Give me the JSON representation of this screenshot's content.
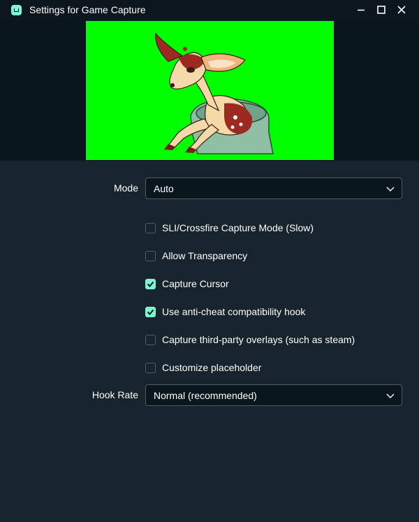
{
  "window": {
    "title": "Settings for Game Capture",
    "icon": "streamlabs-app-icon",
    "controls": [
      "minimize-icon",
      "maximize-icon",
      "close-icon"
    ]
  },
  "preview": {
    "background_color": "#00ff00",
    "subject": "deer-in-teacup-illustration"
  },
  "form": {
    "mode": {
      "label": "Mode",
      "value": "Auto"
    },
    "checkboxes": [
      {
        "label": "SLI/Crossfire Capture Mode (Slow)",
        "checked": false
      },
      {
        "label": "Allow Transparency",
        "checked": false
      },
      {
        "label": "Capture Cursor",
        "checked": true
      },
      {
        "label": "Use anti-cheat compatibility hook",
        "checked": true
      },
      {
        "label": "Capture third-party overlays (such as steam)",
        "checked": false
      },
      {
        "label": "Customize placeholder",
        "checked": false
      }
    ],
    "hook_rate": {
      "label": "Hook Rate",
      "value": "Normal (recommended)"
    }
  },
  "colors": {
    "accent": "#80f5d2",
    "background": "#17242d",
    "titlebar": "#0b161e",
    "input_background": "#09161d",
    "input_border": "#4f5e65"
  }
}
